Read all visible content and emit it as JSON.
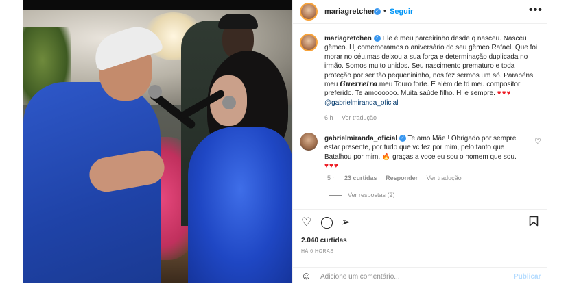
{
  "post": {
    "username": "mariagretchen",
    "separator": "•",
    "follow_label": "Seguir",
    "more_icon": "more-horizontal-icon"
  },
  "caption": {
    "username": "mariagretchen",
    "text_1": "Ele é meu parceirinho desde q nasceu. Nasceu gêmeo. Hj comemoramos o aniversário do seu gêmeo Rafael. Que foi morar no céu.mas deixou a sua força e determinação duplicada no irmão. Somos muito unidos. Seu nascimento prematuro e toda proteção por ser tão pequenininho, nos fez sermos um só. Parabéns meu ",
    "fancy_word": "Guerreiro",
    "text_2": ".meu Touro forte. E além de td meu compositor preferido. Te amoooooo. Muita saúde filho. Hj e sempre. ",
    "hearts": "♥♥♥",
    "mention": "@gabrielmiranda_oficial",
    "time": "6 h",
    "translate": "Ver tradução"
  },
  "comment": {
    "username": "gabrielmiranda_oficial",
    "text": "Te amo Mãe ! Obrigado por sempre estar presente, por tudo que vc fez por mim, pelo tanto que Batalhou por mim. 🔥 graças a voce eu sou o homem que sou.",
    "hearts": "♥♥♥",
    "time": "5 h",
    "likes": "23 curtidas",
    "reply": "Responder",
    "translate": "Ver tradução",
    "like_icon": "heart-outline-icon"
  },
  "replies_label": "Ver respostas (2)",
  "actions": {
    "like_icon": "heart-outline-icon",
    "comment_icon": "comment-icon",
    "share_icon": "share-icon",
    "save_icon": "bookmark-icon"
  },
  "likes_count": "2.040 curtidas",
  "posted_time": "HÁ 6 HORAS",
  "add_comment": {
    "placeholder": "Adicione um comentário...",
    "publish_label": "Publicar",
    "emoji_icon": "emoji-icon"
  },
  "colors": {
    "accent": "#0095f6",
    "verified": "#3897f0",
    "heart": "#ed1c24",
    "muted": "#8e8e8e"
  }
}
